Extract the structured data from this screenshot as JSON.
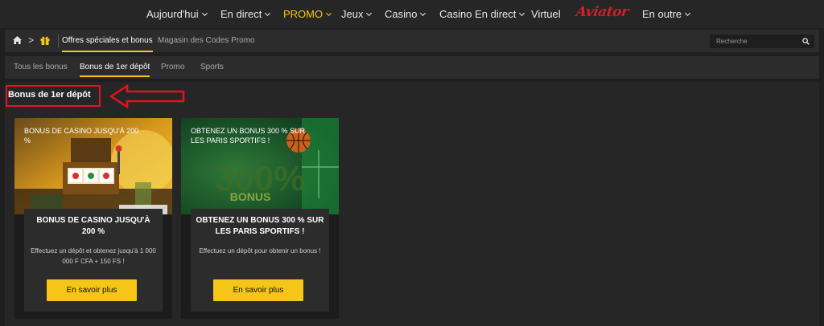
{
  "nav": {
    "items": [
      {
        "label": "Aujourd'hui",
        "dropdown": true
      },
      {
        "label": "En direct",
        "dropdown": true
      },
      {
        "label": "PROMO",
        "dropdown": true
      },
      {
        "label": "Jeux",
        "dropdown": true
      },
      {
        "label": "Casino",
        "dropdown": true
      },
      {
        "label": "Casino En direct",
        "dropdown": true
      },
      {
        "label": "Virtuel",
        "dropdown": false
      },
      {
        "label": "Aviator",
        "dropdown": false
      },
      {
        "label": "En outre",
        "dropdown": true
      }
    ],
    "active_color": "#f5c518"
  },
  "breadcrumb": {
    "separator": ">",
    "active": "Offres spéciales et bonus",
    "link": "Magasin des Codes Promo"
  },
  "search": {
    "placeholder": "Recherche"
  },
  "subtabs": [
    "Tous les bonus",
    "Bonus de 1er dépôt",
    "Promo",
    "Sports"
  ],
  "section_title": "Bonus de 1er dépôt",
  "cards": [
    {
      "image_text": "BONUS DE CASINO JUSQU'À 200 %",
      "title": "BONUS DE CASINO JUSQU'À 200 %",
      "description": "Effectuez un dépôt et obtenez jusqu'à 1 000 000 F CFA + 150 FS !",
      "button": "En savoir plus"
    },
    {
      "image_text": "OBTENEZ UN BONUS 300 % SUR LES PARIS SPORTIFS !",
      "title": "OBTENEZ UN BONUS 300 % SUR LES PARIS SPORTIFS !",
      "description": "Effectuez un dépôt pour obtenir un bonus !",
      "button": "En savoir plus",
      "banner_big_text": "300%",
      "banner_small_text": "BONUS"
    }
  ],
  "colors": {
    "accent": "#f5c518",
    "highlight_red": "#e0141e",
    "aviator_red": "#d21e2a"
  }
}
